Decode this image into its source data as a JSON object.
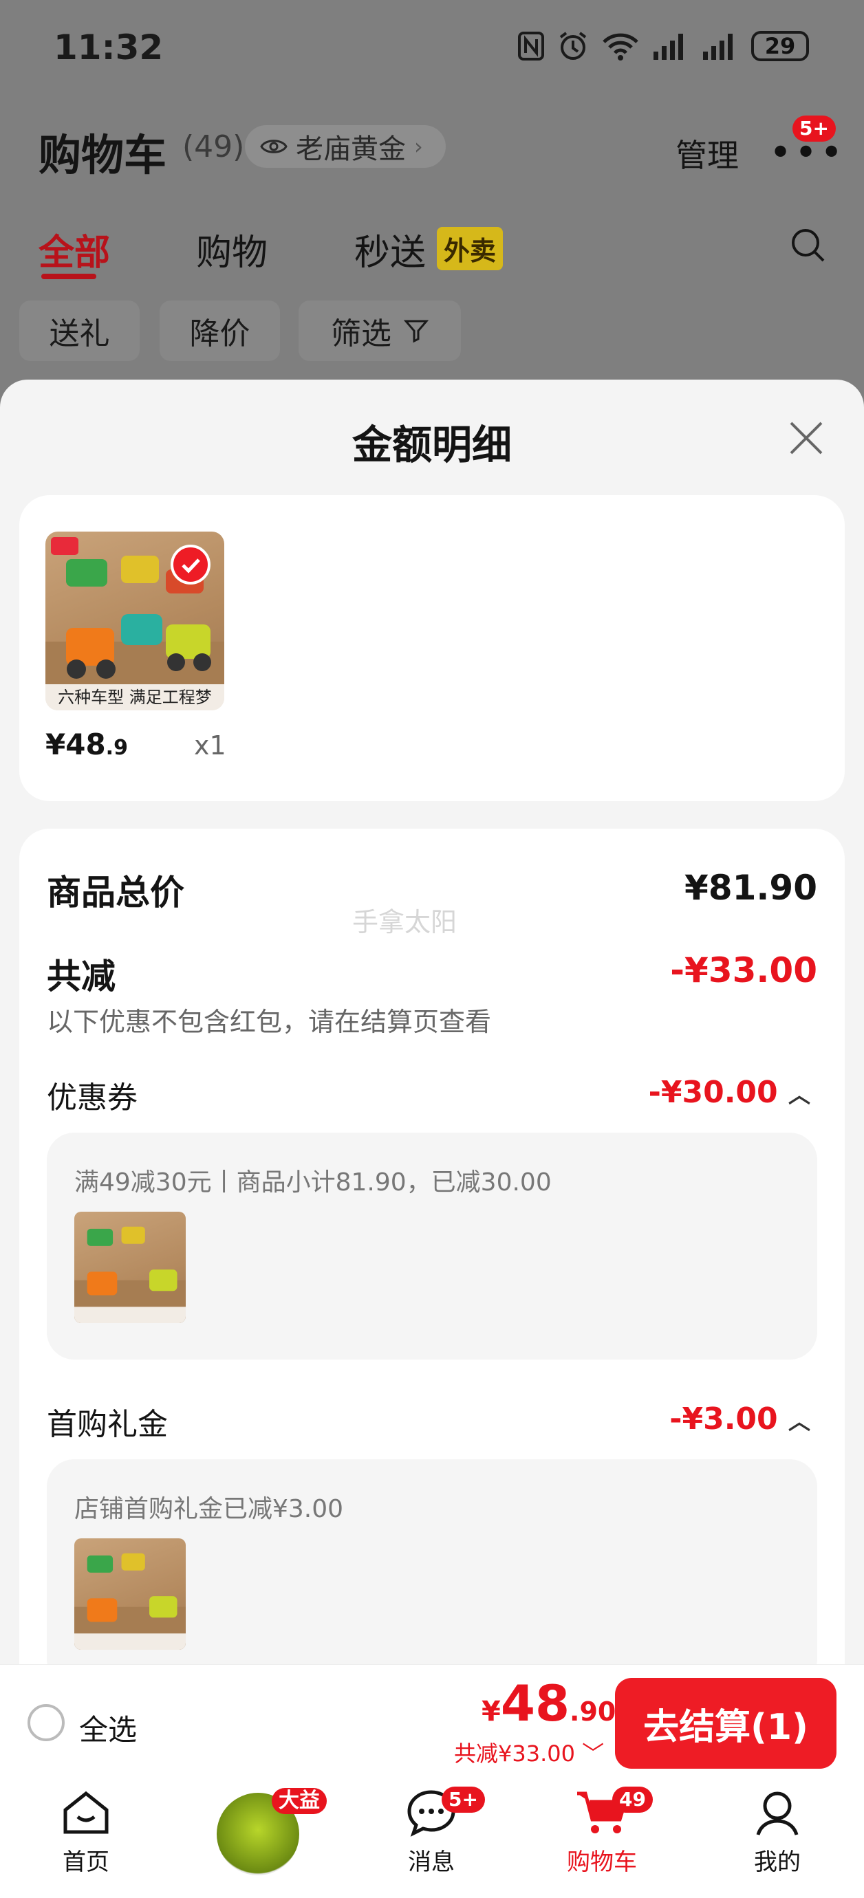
{
  "status_bar": {
    "time": "11:32",
    "battery": "29"
  },
  "header": {
    "title": "购物车",
    "count": "(49)",
    "address": "老庙黄金",
    "manage": "管理",
    "more_badge": "5+"
  },
  "tabs": [
    {
      "label": "全部"
    },
    {
      "label": "购物"
    },
    {
      "label": "秒送"
    }
  ],
  "takeout_tag": "外卖",
  "chips": {
    "gift": "送礼",
    "drop": "降价",
    "filter": "筛选"
  },
  "sheet": {
    "title": "金额明细",
    "item": {
      "caption": "六种车型 满足工程梦",
      "price_int": "¥48",
      "price_dec": ".9",
      "qty": "x1"
    },
    "total_label": "商品总价",
    "total_value": "¥81.90",
    "watermark": "手拿太阳",
    "reduce_label": "共减",
    "reduce_value": "-¥33.00",
    "reduce_note": "以下优惠不包含红包，请在结算页查看",
    "coupon": {
      "label": "优惠券",
      "value": "-¥30.00",
      "desc": "满49减30元丨商品小计81.90，已减30.00"
    },
    "first_gift": {
      "label": "首购礼金",
      "value": "-¥3.00",
      "desc": "店铺首购礼金已减¥3.00"
    }
  },
  "checkout": {
    "select_all": "全选",
    "currency": "¥",
    "amount_int": "48",
    "amount_dec": ".90",
    "discount": "共减¥33.00",
    "button": "去结算(1)"
  },
  "nav": {
    "home": "首页",
    "promo_badge": "大益",
    "messages": "消息",
    "messages_badge": "5+",
    "cart": "购物车",
    "cart_badge": "49",
    "me": "我的"
  },
  "colors": {
    "accent": "#e8141e",
    "tab_active": "#b8121a",
    "takeout_tag": "#d6b81a"
  }
}
